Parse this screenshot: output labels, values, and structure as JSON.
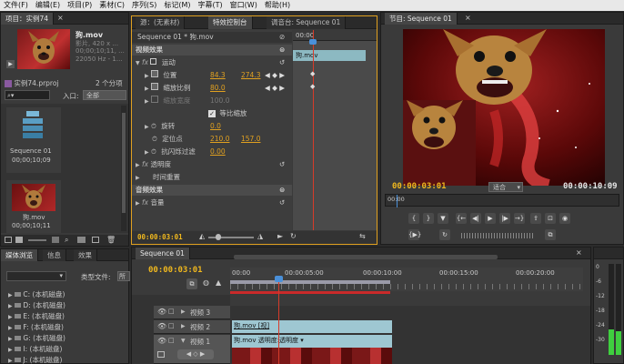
{
  "menu": [
    "文件(F)",
    "编辑(E)",
    "项目(P)",
    "素材(C)",
    "序列(S)",
    "标记(M)",
    "字幕(T)",
    "窗口(W)",
    "帮助(H)"
  ],
  "project": {
    "tab": "项目：实例74",
    "tab_menu": "×",
    "clip_name": "狗.mov",
    "clip_info": [
      "影片, 420 x ...",
      "00;00;10;11, ...",
      "22050 Hz - 1..."
    ],
    "file": "实例74.prproj",
    "count": "2 个分项",
    "search_icon": "search-icon",
    "inlet_label": "入口:",
    "inlet_value": "全部",
    "items": [
      {
        "name": "Sequence 01",
        "duration": "00;00;10;09"
      },
      {
        "name": "狗.mov",
        "duration": "00;00;10;11"
      }
    ]
  },
  "effect_controls": {
    "tabs": [
      "源：(无素材)",
      "特效控制台",
      "调音台: Sequence 01"
    ],
    "header": "Sequence 01 * 狗.mov",
    "ruler_time": "00:00",
    "clip_label": "狗.mov",
    "section_video": "视频效果",
    "section_audio": "音频效果",
    "motion": "运动",
    "position_label": "位置",
    "position_x": "84.3",
    "position_y": "274.3",
    "scale_label": "缩放比例",
    "scale_value": "80.0",
    "scale_width_label": "缩放宽度",
    "scale_width_value": "100.0",
    "uniform_label": "等比缩放",
    "rotation_label": "旋转",
    "rotation_value": "0.0",
    "anchor_label": "定位点",
    "anchor_x": "210.0",
    "anchor_y": "157.0",
    "antiflicker_label": "抗闪烁过滤",
    "antiflicker_value": "0.00",
    "opacity": "透明度",
    "time_remap": "时间重置",
    "volume": "音量",
    "footer_time": "00:00:03:01"
  },
  "program": {
    "tab": "节目: Sequence 01",
    "tab_menu": "×",
    "current_time": "00:00:03:01",
    "fit": "适合",
    "duration": "00:00:10:09",
    "ruler_start": "00:00"
  },
  "media_browser": {
    "tabs": [
      "媒体浏览",
      "信息",
      "效果"
    ],
    "filetype_label": "类型文件:",
    "filetype_value": "所",
    "drives": [
      "C: (本机磁盘)",
      "D: (本机磁盘)",
      "E: (本机磁盘)",
      "F: (本机磁盘)",
      "G: (本机磁盘)",
      "I: (本机磁盘)",
      "J: (本机磁盘)"
    ]
  },
  "timeline": {
    "tab": "Sequence 01",
    "tab_menu": "×",
    "current_time": "00:00:03:01",
    "ruler": [
      "00:00",
      "00:00:05:00",
      "00:00:10:00",
      "00:00:15:00",
      "00:00:20:00"
    ],
    "tracks": [
      "视频 3",
      "视频 2",
      "视频 1"
    ],
    "clip_v2": "狗.mov [视]",
    "clip_v1": "狗.mov  透明度:透明度 ▾"
  },
  "audio_meter": {
    "labels": [
      "0",
      "-6",
      "-12",
      "-18",
      "-24",
      "-30"
    ]
  },
  "colors": {
    "accent": "#f0b81e",
    "playhead": "#d63b2a",
    "clip_video": "#8fc1c9",
    "selected_tab": "#454545"
  }
}
